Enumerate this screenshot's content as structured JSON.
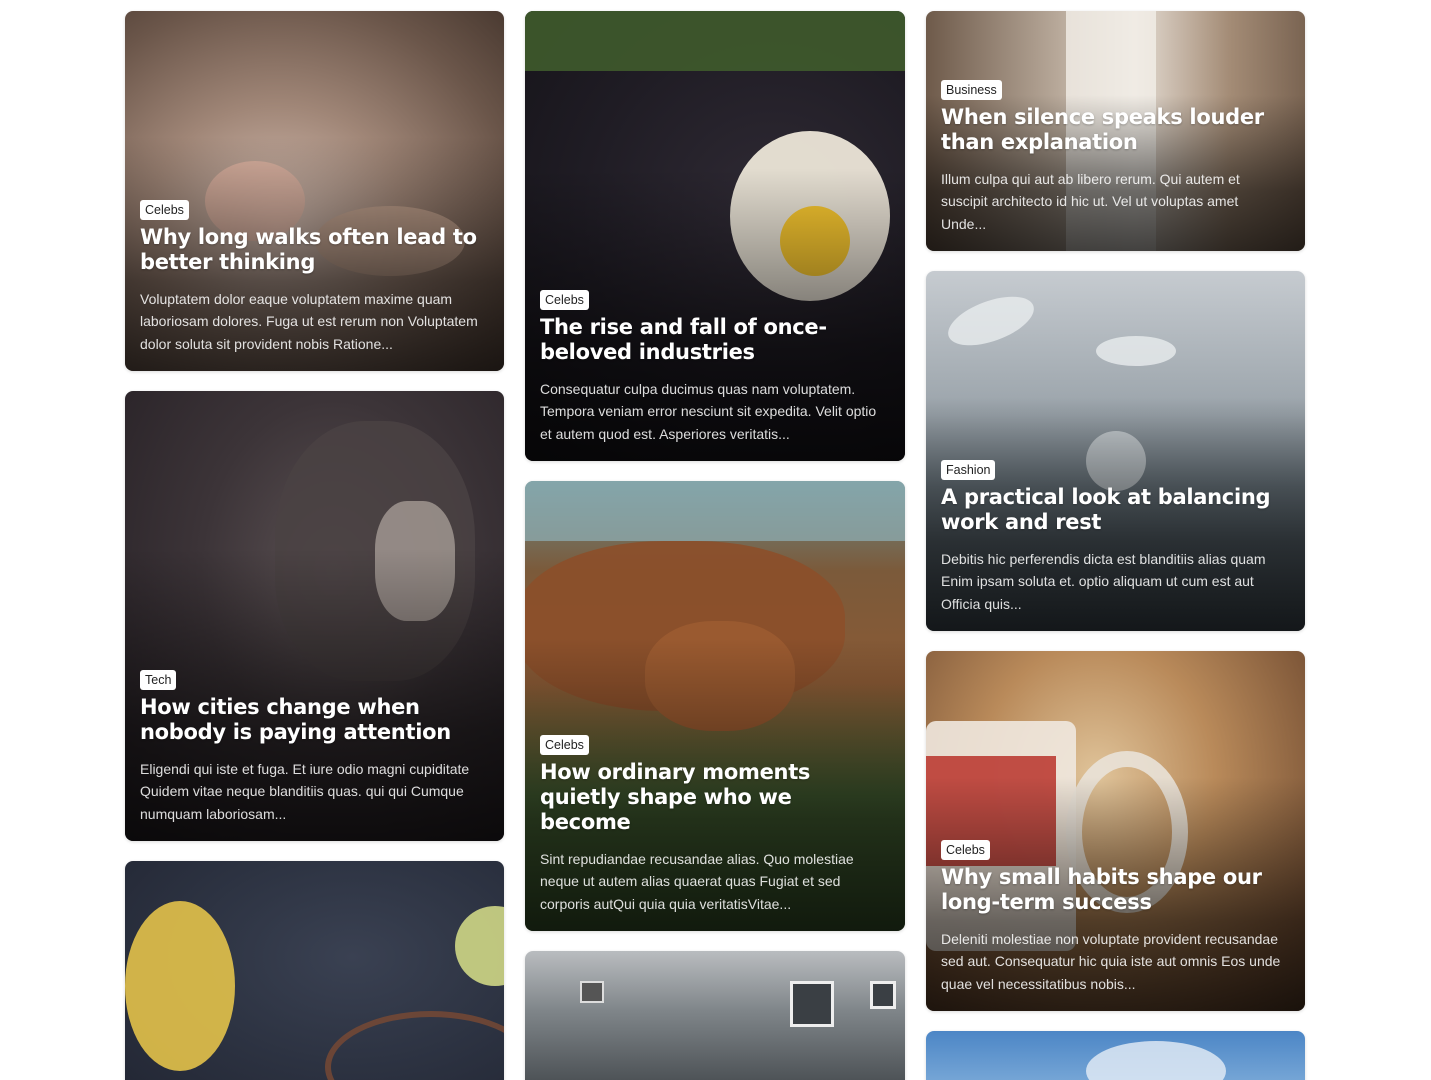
{
  "cards": [
    {
      "category": "Celebs",
      "title": "Why long walks often lead to better thinking",
      "excerpt": "Voluptatem dolor eaque voluptatem maxime quam laboriosam dolores. Fuga ut est rerum non Voluptatem dolor soluta sit provident nobis Ratione..."
    },
    {
      "category": "Tech",
      "title": "How cities change when nobody is paying attention",
      "excerpt": "Eligendi qui iste et fuga. Et iure odio magni cupiditate Quidem vitae neque blanditiis quas. qui qui Cumque numquam laboriosam..."
    },
    {
      "category": "",
      "title": "",
      "excerpt": ""
    },
    {
      "category": "Celebs",
      "title": "The rise and fall of once-beloved industries",
      "excerpt": "Consequatur culpa ducimus quas nam voluptatem. Tempora veniam error nesciunt sit expedita. Velit optio et autem quod est. Asperiores veritatis..."
    },
    {
      "category": "Celebs",
      "title": "How ordinary moments quietly shape who we become",
      "excerpt": "Sint repudiandae recusandae alias. Quo molestiae neque ut autem alias quaerat quas Fugiat et sed corporis autQui quia quia veritatisVitae..."
    },
    {
      "category": "",
      "title": "",
      "excerpt": ""
    },
    {
      "category": "Business",
      "title": "When silence speaks louder than explanation",
      "excerpt": "Illum culpa qui aut ab libero rerum. Qui autem et suscipit architecto id hic ut. Vel ut voluptas amet Unde..."
    },
    {
      "category": "Fashion",
      "title": "A practical look at balancing work and rest",
      "excerpt": "Debitis hic perferendis dicta est blanditiis alias quam Enim ipsam soluta et. optio aliquam ut cum est aut Officia quis..."
    },
    {
      "category": "Celebs",
      "title": "Why small habits shape our long-term success",
      "excerpt": "Deleniti molestiae non voluptate provident recusandae sed aut. Consequatur hic quia iste aut omnis Eos unde quae vel necessitatibus nobis..."
    },
    {
      "category": "",
      "title": "",
      "excerpt": ""
    }
  ]
}
